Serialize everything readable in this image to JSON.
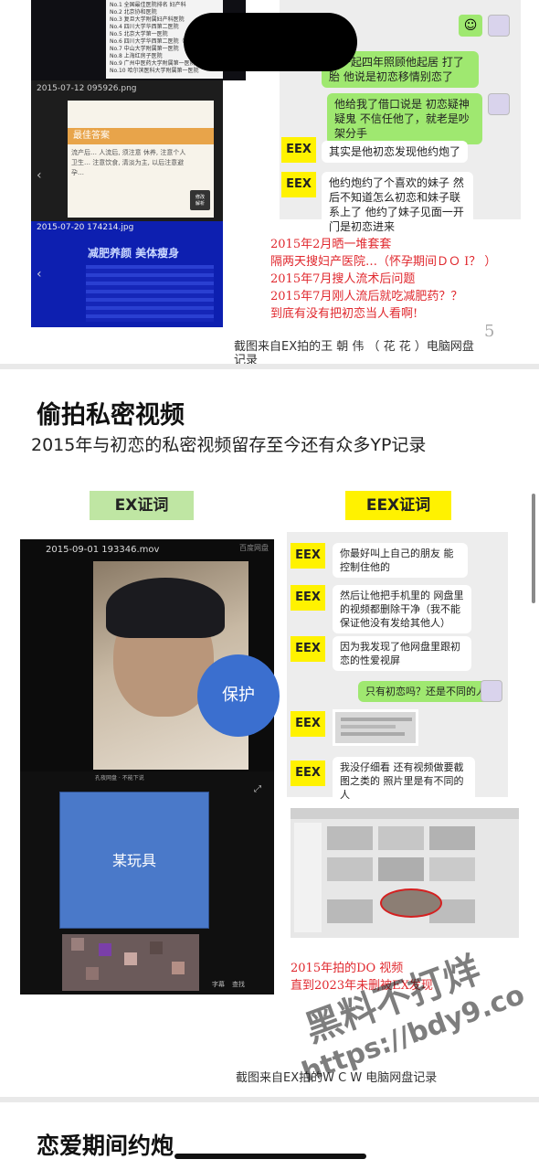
{
  "slide1": {
    "list_items": [
      "No.1 全国最佳医院排名 妇产科",
      "No.2 北京协和医院",
      "No.3 复旦大学附属妇产科医院",
      "No.4 四川大学华西第二医院",
      "No.5 北京大学第一医院",
      "No.6 四川大学华西第二医院（华",
      "No.7 中山大学附属第一医院",
      "No.8 上海红房子医院",
      "No.9 广州中医药大学附属第一医院",
      "No.10 哈尔滨医科大学附属第一医院"
    ],
    "file1": "2015-07-12 095926.png",
    "best_answer": "最佳答案",
    "answer_text": "流产后… 人流后, 须注意 休养, 注意个人卫生… 注意饮食, 清淡为主, 以后注意避孕…",
    "btn_text": "修改\n解析",
    "file2": "2015-07-20 174214.jpg",
    "banner": "减肥养颜 美体瘦身",
    "chat": {
      "m1": "在一起四年照顾他起居 打了胎 他说是初恋移情别恋了",
      "m2": "他给我了借口说是 初恋疑神疑鬼 不信任他了，就老是吵架分手",
      "eex": "EEX",
      "m3": "其实是他初恋发现他约炮了",
      "m4": "他约炮约了个喜欢的妹子 然后不知道怎么初恋和妹子联系上了 他约了妹子见面一开门是初恋进来"
    },
    "red_lines": [
      "2015年2月晒一堆套套",
      "隔两天搜妇产医院…（怀孕期间ＤＯ I？ ）",
      "2015年7月搜人流术后问题",
      "2015年7月刚人流后就吃减肥药？？",
      "到底有没有把初恋当人看啊!"
    ],
    "page_no": "5",
    "caption": "截图来自EX拍的王 朝 伟 （ 花 花 ）电脑网盘记录"
  },
  "slide2": {
    "title": "偷拍私密视频",
    "subtitle": "2015年与初恋的私密视频留存至今还有众多YP记录",
    "ex_label": "EX证词",
    "eex_label": "EEX证词",
    "video_file": "2015-09-01 193346.mov",
    "video_app": "百度网盘",
    "circle_text": "保护",
    "toy_text": "某玩具",
    "bar_text": "孔夜网盘 · 不能下说",
    "toolbar": [
      "字幕",
      "查找"
    ],
    "eex": "EEX",
    "chat": {
      "m1": "你最好叫上自己的朋友 能控制住他的",
      "m2": "然后让他把手机里的 网盘里的视频都删除干净（我不能保证他没有发给其他人）",
      "m3": "因为我发现了他网盘里跟初恋的性爱视屏",
      "m4": "只有初恋吗？还是不同的人",
      "m6": "我没仔细看 还有视频做要截图之类的 照片里是有不同的人"
    },
    "red_lines": [
      "2015年拍的DO 视频",
      "直到2023年未删被EX发现"
    ],
    "caption": "截图来自EX拍的W C W 电脑网盘记录",
    "watermark1": "黑料不打烊",
    "watermark2": "https://bdy9.co"
  },
  "slide3": {
    "title": "恋爱期间约炮"
  },
  "colors": {
    "eex_yellow": "#fff200",
    "ex_green": "#bfe6a3",
    "chat_green": "#9fe870",
    "red": "#e0282e",
    "circle_blue": "#3b6fcf",
    "toy_blue": "#4a79c9"
  }
}
